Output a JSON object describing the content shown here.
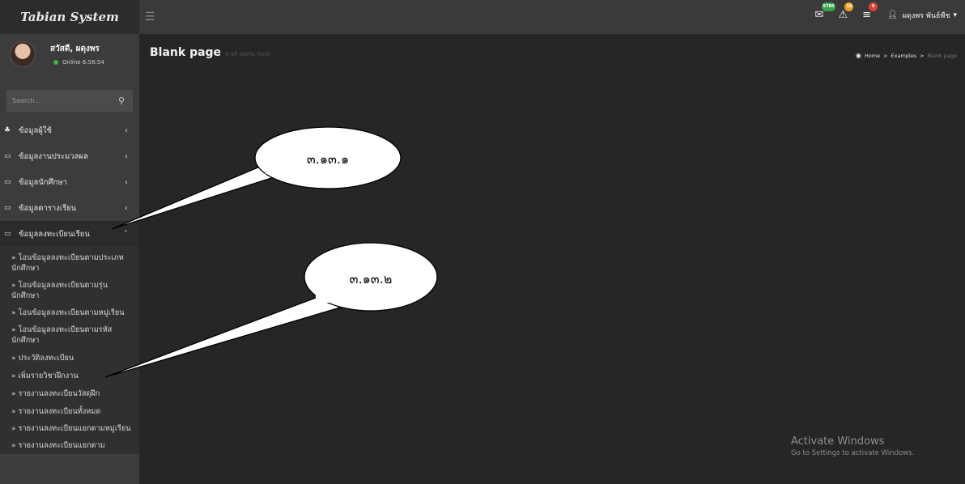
{
  "app": {
    "title": "Tabian System"
  },
  "user_panel": {
    "greeting": "สวัสดี, ผดุงพร",
    "status": "Online 6:56:54"
  },
  "search": {
    "placeholder": "Search..."
  },
  "sidebar": {
    "items": [
      {
        "label": "ข้อมูลผู้ใช้",
        "icon": "users-icon"
      },
      {
        "label": "ข้อมูลงานประมวลผล",
        "icon": "laptop-icon"
      },
      {
        "label": "ข้อมูลนักศึกษา",
        "icon": "laptop-icon"
      },
      {
        "label": "ข้อมูลตารางเรียน",
        "icon": "laptop-icon"
      },
      {
        "label": "ข้อมูลลงทะเบียนเรียน",
        "icon": "laptop-icon"
      }
    ],
    "subitems": [
      "» โอนข้อมูลลงทะเบียนตามประเภทนักศึกษา",
      "» โอนข้อมูลลงทะเบียนตามรุ่นนักศึกษา",
      "» โอนข้อมูลลงทะเบียนตามหมู่เรียน",
      "» โอนข้อมูลลงทะเบียนตามรหัสนักศึกษา",
      "» ประวัติลงทะเบียน",
      "» เพิ่มรายวิชาฝึกงาน",
      "» รายงานลงทะเบียนวัสดุฝึก",
      "» รายงานลงทะเบียนทั้งหมด",
      "» รายงานลงทะเบียนแยกตามหมู่เรียน",
      "» รายงานลงทะเบียนแยกตาม"
    ]
  },
  "topbar": {
    "messages_badge": "5780",
    "alerts_badge": "10",
    "tasks_badge": "9",
    "user_name": "ผดุงพร พันธ์พืช"
  },
  "page": {
    "title": "Blank page",
    "subtitle": "it all starts here",
    "breadcrumb": [
      "Home",
      "Examples",
      "Blank page"
    ]
  },
  "watermark": {
    "title": "Activate Windows",
    "subtitle": "Go to Settings to activate Windows."
  },
  "callouts": {
    "first": "๓.๑๓.๑",
    "second": "๓.๑๓.๒"
  },
  "colors": {
    "badge_green": "#3aa04a",
    "badge_orange": "#f0a020",
    "badge_red": "#d9443a"
  }
}
